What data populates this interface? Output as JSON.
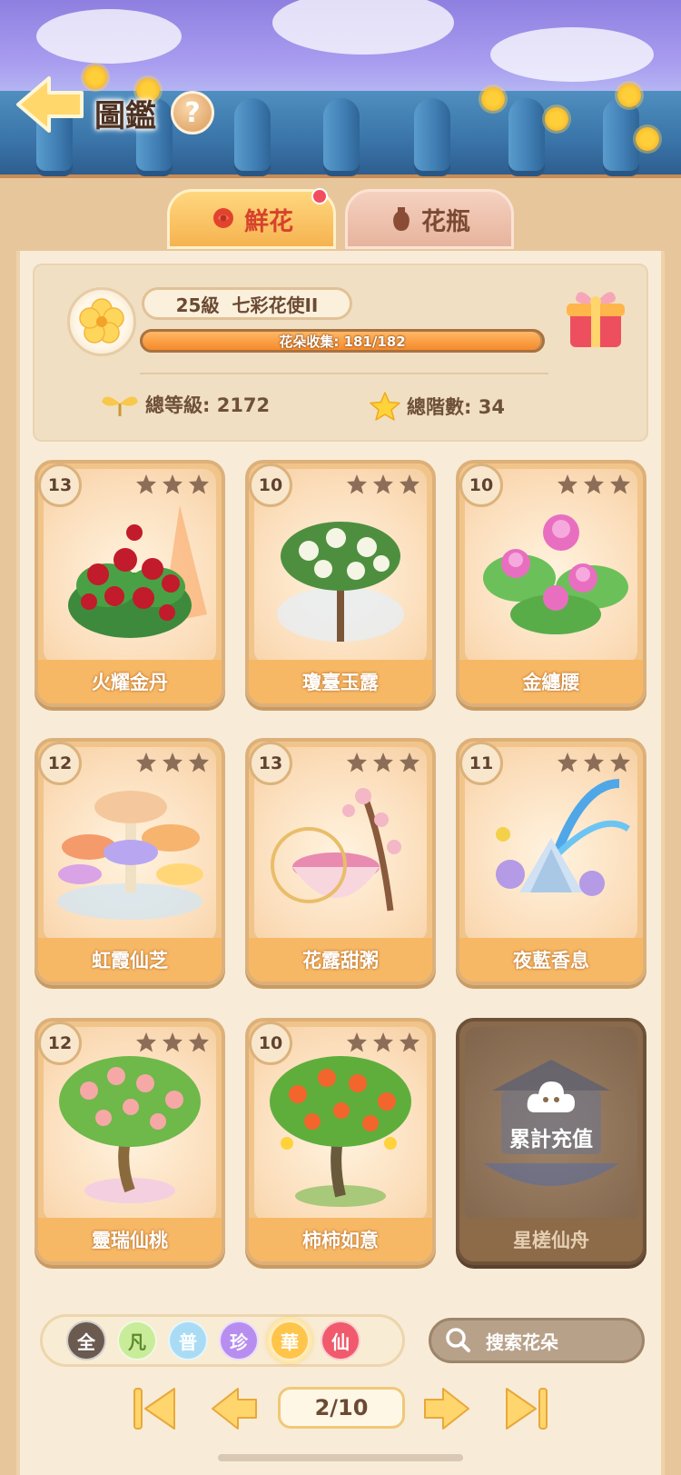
{
  "header": {
    "title": "圖鑑",
    "help_label": "?"
  },
  "tabs": [
    {
      "label": "鮮花",
      "active": true,
      "has_notification": true
    },
    {
      "label": "花瓶",
      "active": false,
      "has_notification": false
    }
  ],
  "stats": {
    "level_label": "25級",
    "rank_title": "七彩花使II",
    "collection_label": "花朵收集: 181/182",
    "collection_progress": 0.9945,
    "total_level_label": "總等級: 2172",
    "total_stars_label": "總階數: 34"
  },
  "cards": [
    {
      "name": "火耀金丹",
      "level": "13",
      "locked": false,
      "art": "red-peony"
    },
    {
      "name": "瓊臺玉露",
      "level": "10",
      "locked": false,
      "art": "white-peony-tree"
    },
    {
      "name": "金纏腰",
      "level": "10",
      "locked": false,
      "art": "pink-lotus"
    },
    {
      "name": "虹霞仙芝",
      "level": "12",
      "locked": false,
      "art": "rainbow-mushroom"
    },
    {
      "name": "花露甜粥",
      "level": "13",
      "locked": false,
      "art": "blossom-bowl"
    },
    {
      "name": "夜藍香息",
      "level": "11",
      "locked": false,
      "art": "blue-crystal-flower"
    },
    {
      "name": "靈瑞仙桃",
      "level": "12",
      "locked": false,
      "art": "peach-tree"
    },
    {
      "name": "柿柿如意",
      "level": "10",
      "locked": false,
      "art": "persimmon-tree"
    },
    {
      "name": "星槎仙舟",
      "level": "",
      "locked": true,
      "lock_label": "累計充值",
      "art": "fairy-boat"
    }
  ],
  "filters": [
    {
      "label": "全",
      "color": "#6b5a50",
      "text_color": "#ffffff",
      "selected": false
    },
    {
      "label": "凡",
      "color": "#c9ec9a",
      "text_color": "#5d8a2e",
      "selected": false
    },
    {
      "label": "普",
      "color": "#a9dcf4",
      "text_color": "#ffffff",
      "selected": false
    },
    {
      "label": "珍",
      "color": "#b78ef0",
      "text_color": "#ffffff",
      "selected": false
    },
    {
      "label": "華",
      "color": "#ffc44a",
      "text_color": "#ffffff",
      "selected": true
    },
    {
      "label": "仙",
      "color": "#f05a6c",
      "text_color": "#ffffff",
      "selected": false
    }
  ],
  "search": {
    "placeholder": "搜索花朵"
  },
  "pagination": {
    "current": "2/10"
  },
  "colors": {
    "accent": "#f58a2b",
    "tab_active_text": "#d6422c",
    "notification": "#f24d5f"
  }
}
